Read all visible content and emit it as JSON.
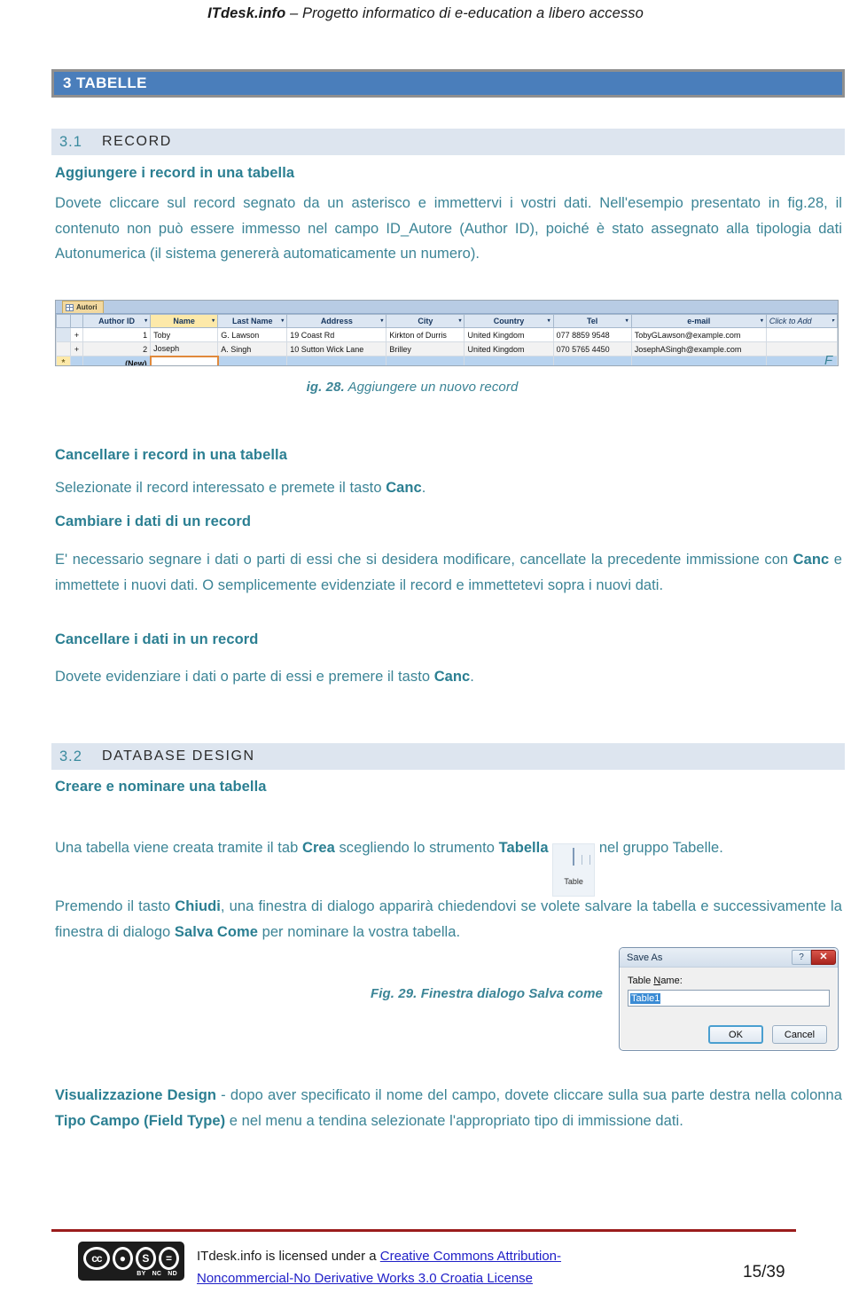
{
  "header": {
    "brand": "ITdesk.info",
    "dash": " – ",
    "tagline": "Progetto informatico di e-education a libero accesso"
  },
  "chapter": {
    "number": "3",
    "title": "TABELLE",
    "label": "3 TABELLE",
    "bar_color": "#4a7ebb",
    "border_color": "#8f8f8f"
  },
  "sections": [
    {
      "number": "3.1",
      "title": "RECORD"
    },
    {
      "number": "3.2",
      "title": "DATABASE DESIGN"
    }
  ],
  "blocks": {
    "h_add_record": "Aggiungere i record in una tabella",
    "p_add_record_1": "Dovete cliccare sul record segnato da un asterisco e immettervi i vostri dati. Nell'esempio presentato in fig.",
    "p_add_record_fig": "28",
    "p_add_record_2": ", il contenuto non può essere immesso nel campo ID_Autore (Author ID), poiché è stato assegnato alla tipologia dati Autonumerica (il sistema genererà automaticamente un numero).",
    "h_delete_records": "Cancellare i record in una tabella",
    "p_delete_records_a": "Selezionate il record interessato e premete il tasto ",
    "p_delete_records_key": "Canc",
    "p_delete_records_b": ".",
    "h_change_data": "Cambiare i dati di un record",
    "p_change_data_a": "E' necessario segnare i dati o parti di essi che si desidera modificare, cancellate la precedente immissione con ",
    "p_change_data_key": "Canc",
    "p_change_data_b": " e immettete i nuovi dati. O semplicemente evidenziate il record e immettetevi sopra i nuovi dati.",
    "h_delete_data": "Cancellare i dati in un record",
    "p_delete_data_a": "Dovete evidenziare i dati o parte di essi e premere il tasto ",
    "p_delete_data_key": "Canc",
    "p_delete_data_b": ".",
    "h_create_table": "Creare e nominare una tabella",
    "p_create_table_a": "Una tabella viene creata tramite il tab ",
    "p_create_table_key1": "Crea",
    "p_create_table_b": " scegliendo lo strumento ",
    "p_create_table_key2": "Tabella",
    "p_create_table_c": " nel gruppo Tabelle.",
    "p_close_a": "Premendo il tasto ",
    "p_close_key1": "Chiudi",
    "p_close_b": ", una finestra di dialogo apparirà chiedendovi se volete salvare la tabella e successivamente la finestra di dialogo ",
    "p_close_key2": "Salva Come",
    "p_close_c": " per nominare la vostra tabella.",
    "p_design_key1": "Visualizzazione Design",
    "p_design_a": " - dopo aver specificato il nome del campo, dovete cliccare sulla sua parte destra nella colonna ",
    "p_design_key2": "Tipo Campo (Field Type)",
    "p_design_b": " e nel menu a tendina selezionate l'appropriato tipo di immissione dati."
  },
  "figures": {
    "fig28": {
      "caption_prefix": "ig. 28.",
      "caption_text": " Aggiungere un nuovo record",
      "overflow_letter": "F"
    },
    "fig29": {
      "caption_prefix": "Fig. 29.",
      "caption_text": " Finestra dialogo Salva come"
    }
  },
  "access_screenshot": {
    "tab_label": "Autori",
    "columns": [
      "Author ID",
      "Name",
      "Last Name",
      "Address",
      "City",
      "Country",
      "Tel",
      "e-mail",
      "Click to Add"
    ],
    "selected_column": "Name",
    "rows": [
      {
        "author_id": "1",
        "name": "Toby",
        "last_name": "G. Lawson",
        "address": "19 Coast Rd",
        "city": "Kirkton of Durris",
        "country": "United Kingdom",
        "tel": "077 8859 9548",
        "email": "TobyGLawson@example.com"
      },
      {
        "author_id": "2",
        "name": "Joseph",
        "last_name": "A. Singh",
        "address": "10 Sutton Wick Lane",
        "city": "Brilley",
        "country": "United Kingdom",
        "tel": "070 5765 4450",
        "email": "JosephASingh@example.com"
      }
    ],
    "new_row_label": "(New)",
    "new_row_marker": "*",
    "expand_marker": "+"
  },
  "ribbon_icon": {
    "label": "Table"
  },
  "save_as_dialog": {
    "title": "Save As",
    "help_glyph": "?",
    "close_glyph": "✕",
    "field_label_pre": "Table ",
    "field_label_underlined": "N",
    "field_label_post": "ame:",
    "field_value": "Table1",
    "ok_label": "OK",
    "cancel_label": "Cancel"
  },
  "footer": {
    "license_pre": "ITdesk.info is licensed under a ",
    "license_link_line1": "Creative Commons Attribution-",
    "license_link_line2": "Noncommercial-No Derivative Works 3.0 Croatia License",
    "page": "15/39",
    "cc_marks": [
      "cc",
      "BY",
      "NC",
      "ND"
    ]
  }
}
